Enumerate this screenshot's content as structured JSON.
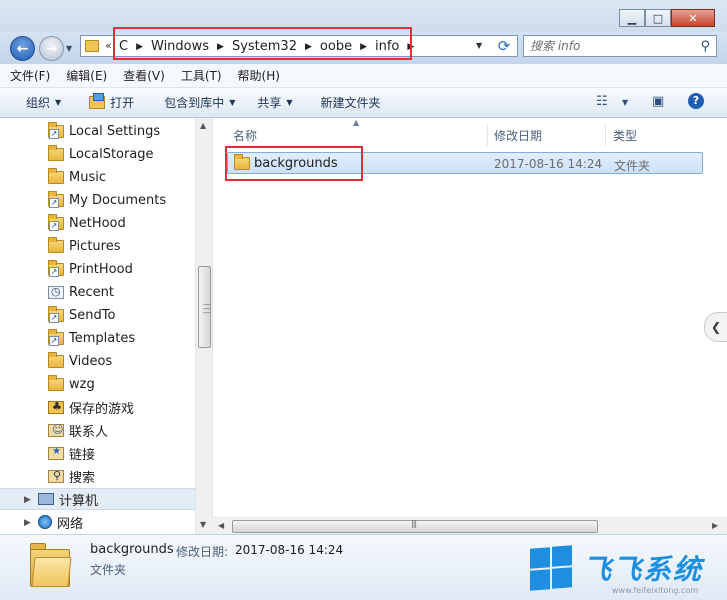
{
  "window": {
    "minimize_glyph": "▁",
    "maximize_glyph": "□",
    "close_glyph": "✕"
  },
  "address": {
    "overflow": "«",
    "crumbs": [
      "C",
      "Windows",
      "System32",
      "oobe",
      "info"
    ],
    "separator": "▶",
    "dropdown": "▼",
    "refresh": "⟳"
  },
  "search": {
    "placeholder": "搜索 info",
    "icon": "search-icon"
  },
  "menu": [
    "文件(F)",
    "编辑(E)",
    "查看(V)",
    "工具(T)",
    "帮助(H)"
  ],
  "toolbar": {
    "organize": "组织",
    "open": "打开",
    "include_library": "包含到库中",
    "share": "共享",
    "new_folder": "新建文件夹",
    "caret": "▼"
  },
  "nav": {
    "items": [
      {
        "label": "Local Settings",
        "icon": "folder-shortcut-icon"
      },
      {
        "label": "LocalStorage",
        "icon": "folder-icon"
      },
      {
        "label": "Music",
        "icon": "folder-icon"
      },
      {
        "label": "My Documents",
        "icon": "folder-shortcut-icon"
      },
      {
        "label": "NetHood",
        "icon": "folder-shortcut-icon"
      },
      {
        "label": "Pictures",
        "icon": "folder-icon"
      },
      {
        "label": "PrintHood",
        "icon": "folder-shortcut-icon"
      },
      {
        "label": "Recent",
        "icon": "recent-icon"
      },
      {
        "label": "SendTo",
        "icon": "folder-shortcut-icon"
      },
      {
        "label": "Templates",
        "icon": "folder-shortcut-icon"
      },
      {
        "label": "Videos",
        "icon": "folder-icon"
      },
      {
        "label": "wzg",
        "icon": "folder-icon"
      },
      {
        "label": "保存的游戏",
        "icon": "saved-games-icon"
      },
      {
        "label": "联系人",
        "icon": "contacts-icon"
      },
      {
        "label": "链接",
        "icon": "links-icon"
      },
      {
        "label": "搜索",
        "icon": "searches-icon"
      }
    ],
    "computer": "计算机",
    "network": "网络"
  },
  "columns": {
    "name": "名称",
    "date": "修改日期",
    "type": "类型"
  },
  "files": [
    {
      "name": "backgrounds",
      "date": "2017-08-16 14:24",
      "type": "文件夹"
    }
  ],
  "details": {
    "name": "backgrounds",
    "date_label": "修改日期:",
    "date": "2017-08-16 14:24",
    "type": "文件夹"
  },
  "watermark": {
    "text": "飞飞系统",
    "url": "www.feifeixitong.com"
  },
  "colors": {
    "accent": "#1e8fe0",
    "highlight_border": "#e0303a",
    "selection": "#cce1f8"
  }
}
